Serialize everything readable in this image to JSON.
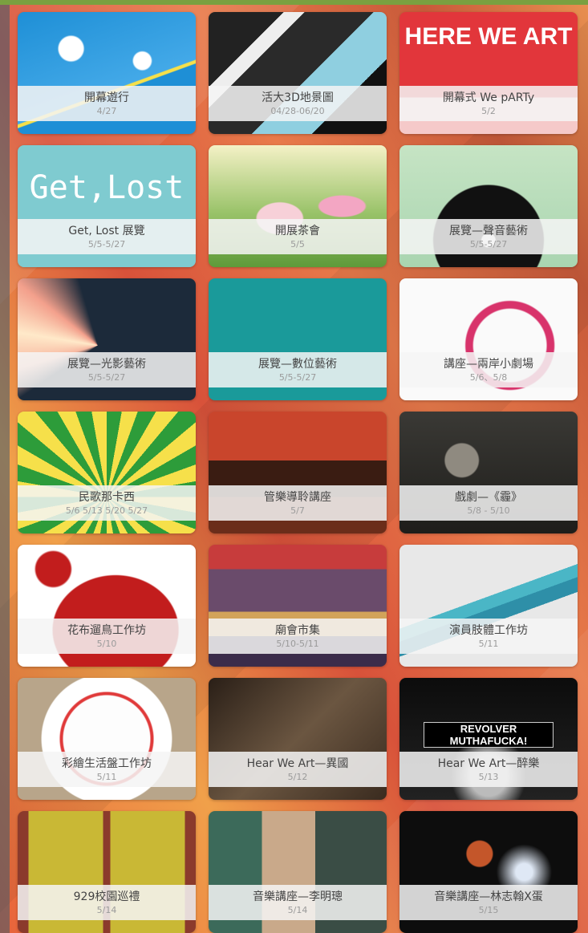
{
  "colors": {
    "accent_top": "#7aa040"
  },
  "tiles": [
    {
      "title": "開幕遊行",
      "date": "4/27",
      "art": "blue-poster",
      "icon": "parade-art"
    },
    {
      "title": "活大3D地景圖",
      "date": "04/28-06/20",
      "art": "dark-cubes",
      "icon": "landscape-art"
    },
    {
      "title": "開幕式 We pARTy",
      "date": "5/2",
      "art": "red-poster",
      "caption": "HERE WE ART",
      "icon": "party-art"
    },
    {
      "title": "Get, Lost 展覽",
      "date": "5/5-5/27",
      "art": "teal-text",
      "caption": "Get,Lost",
      "icon": "exhibition-art"
    },
    {
      "title": "開展茶會",
      "date": "5/5",
      "art": "garden",
      "icon": "tea-party-art"
    },
    {
      "title": "展覽—聲音藝術",
      "date": "5/5-5/27",
      "art": "record",
      "icon": "vinyl-record-icon"
    },
    {
      "title": "展覽—光影藝術",
      "date": "5/5-5/27",
      "art": "light",
      "icon": "light-beam-art"
    },
    {
      "title": "展覽—數位藝術",
      "date": "5/5-5/27",
      "art": "arduino",
      "icon": "arduino-logo-icon"
    },
    {
      "title": "講座—兩岸小劇場",
      "date": "5/6、5/8",
      "art": "live-your-life",
      "icon": "stamp-art"
    },
    {
      "title": "民歌那卡西",
      "date": "5/6 5/13 5/20 5/27",
      "art": "fist-mic",
      "icon": "microphone-fist-icon"
    },
    {
      "title": "管樂導聆講座",
      "date": "5/7",
      "art": "orchestra",
      "icon": "orchestra-art"
    },
    {
      "title": "戲劇—《霾》",
      "date": "5/8 - 5/10",
      "art": "calligraphy",
      "icon": "calligraphy-art"
    },
    {
      "title": "花布遛鳥工作坊",
      "date": "5/10",
      "art": "red-bird",
      "icon": "bird-icon"
    },
    {
      "title": "廟會市集",
      "date": "5/10-5/11",
      "art": "temple-fair",
      "icon": "temple-fair-art"
    },
    {
      "title": "演員肢體工作坊",
      "date": "5/11",
      "art": "origami",
      "icon": "origami-bird-icon"
    },
    {
      "title": "彩繪生活盤工作坊",
      "date": "5/11",
      "art": "plate",
      "icon": "painted-plate-art"
    },
    {
      "title": "Hear We Art—異國",
      "date": "5/12",
      "art": "sitar",
      "icon": "sitar-player-art"
    },
    {
      "title": "Hear We Art—醉樂",
      "date": "5/13",
      "art": "band",
      "caption": "REVOLVER MUTHAFUCKA!",
      "icon": "band-stage-art"
    },
    {
      "title": "929校園巡禮",
      "date": "5/14",
      "art": "window",
      "icon": "band-window-art"
    },
    {
      "title": "音樂講座—李明璁",
      "date": "5/14",
      "art": "speaker1",
      "icon": "speaker-portrait-art"
    },
    {
      "title": "音樂講座—林志翰X蛋",
      "date": "5/15",
      "art": "speaker2",
      "icon": "concert-stage-art"
    }
  ]
}
